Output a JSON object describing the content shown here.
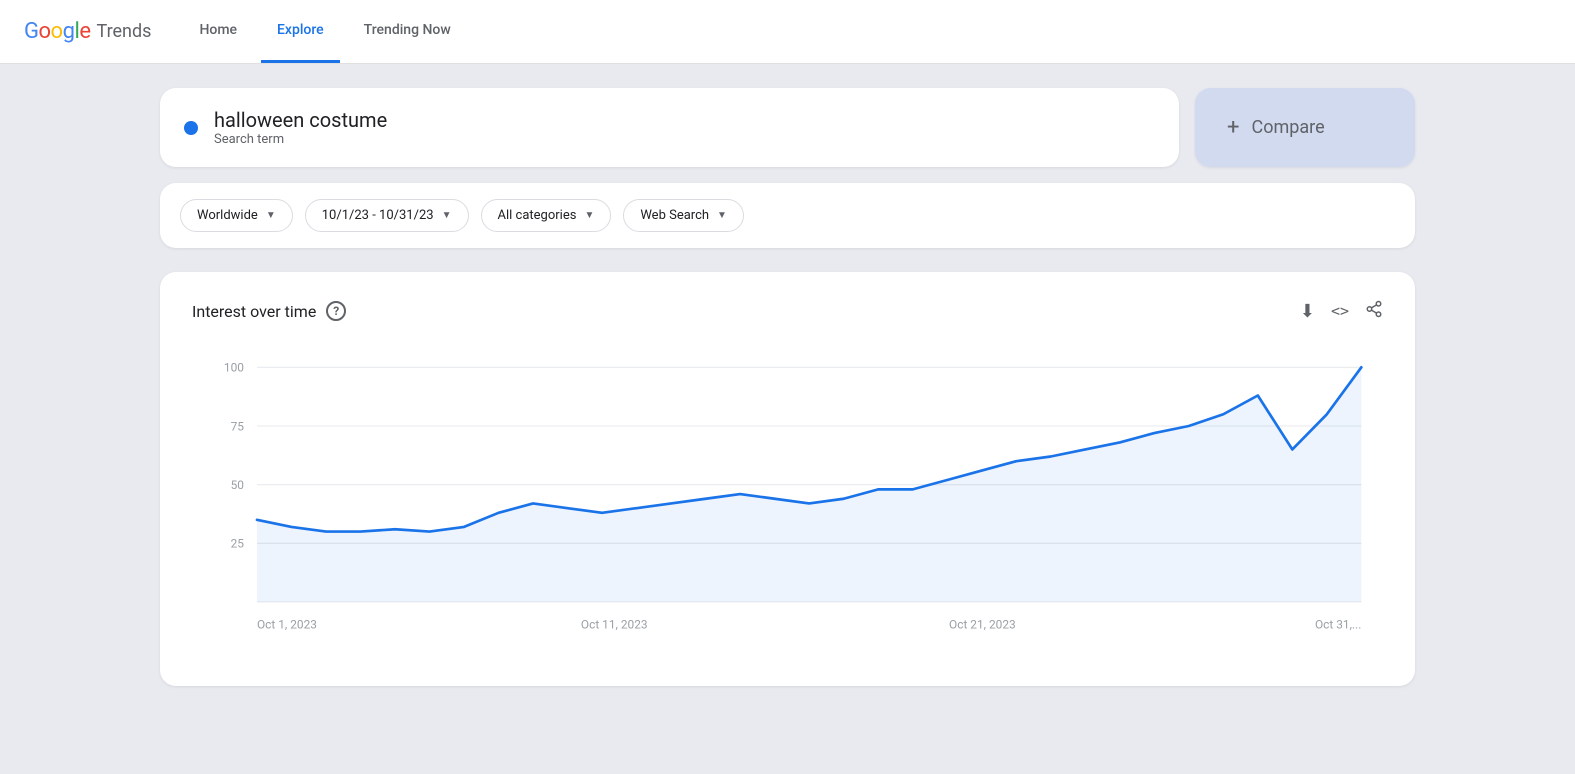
{
  "header": {
    "logo_google": "Google",
    "logo_trends": "Trends",
    "nav": [
      {
        "id": "home",
        "label": "Home",
        "active": false
      },
      {
        "id": "explore",
        "label": "Explore",
        "active": true
      },
      {
        "id": "trending",
        "label": "Trending Now",
        "active": false
      }
    ]
  },
  "search": {
    "term": "halloween costume",
    "type": "Search term",
    "dot_color": "#1a73e8"
  },
  "compare": {
    "label": "Compare",
    "plus": "+"
  },
  "filters": [
    {
      "id": "region",
      "label": "Worldwide",
      "has_chevron": true
    },
    {
      "id": "date",
      "label": "10/1/23 - 10/31/23",
      "has_chevron": true
    },
    {
      "id": "category",
      "label": "All categories",
      "has_chevron": true
    },
    {
      "id": "search_type",
      "label": "Web Search",
      "has_chevron": true
    }
  ],
  "chart": {
    "title": "Interest over time",
    "help_label": "?",
    "y_axis": [
      {
        "value": 100,
        "label": "100"
      },
      {
        "value": 75,
        "label": "75"
      },
      {
        "value": 50,
        "label": "50"
      },
      {
        "value": 25,
        "label": "25"
      }
    ],
    "x_axis": [
      {
        "label": "Oct 1, 2023",
        "x_pct": 0
      },
      {
        "label": "Oct 11, 2023",
        "x_pct": 32
      },
      {
        "label": "Oct 21, 2023",
        "x_pct": 65
      },
      {
        "label": "Oct 31,...",
        "x_pct": 97
      }
    ],
    "data_points": [
      35,
      32,
      30,
      30,
      31,
      30,
      32,
      38,
      42,
      40,
      38,
      40,
      42,
      44,
      46,
      44,
      42,
      44,
      48,
      48,
      52,
      56,
      60,
      62,
      65,
      68,
      72,
      75,
      80,
      88,
      65,
      80,
      100
    ],
    "actions": [
      {
        "id": "download",
        "icon": "⬇",
        "label": "download-icon"
      },
      {
        "id": "embed",
        "icon": "<>",
        "label": "embed-icon"
      },
      {
        "id": "share",
        "icon": "↗",
        "label": "share-icon"
      }
    ]
  }
}
